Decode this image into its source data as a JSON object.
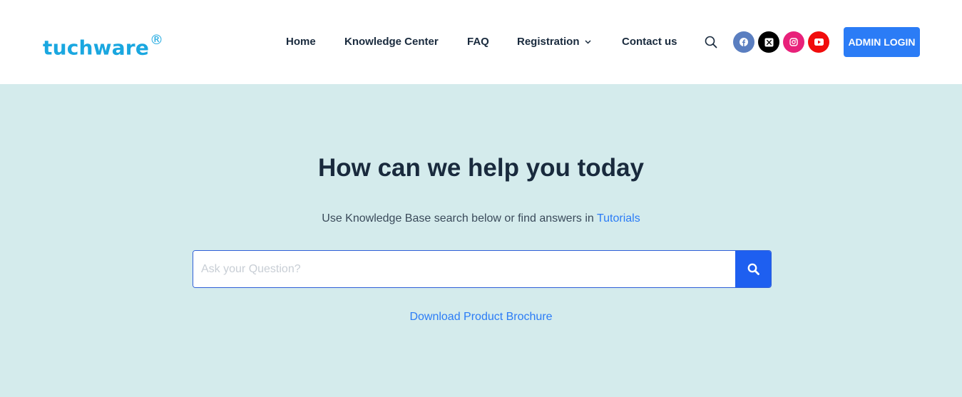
{
  "header": {
    "logo_text": "tuchware",
    "logo_mark": "®",
    "nav": [
      {
        "label": "Home"
      },
      {
        "label": "Knowledge Center"
      },
      {
        "label": "FAQ"
      },
      {
        "label": "Registration"
      },
      {
        "label": "Contact us"
      }
    ],
    "search_icon": "search-icon",
    "social": [
      {
        "icon": "facebook-icon",
        "color": "#5a7ec0"
      },
      {
        "icon": "x-twitter-icon",
        "color": "#000000"
      },
      {
        "icon": "instagram-icon",
        "color": "#e8217a"
      },
      {
        "icon": "youtube-icon",
        "color": "#f10c0c"
      }
    ],
    "admin_login_label": "ADMIN LOGIN"
  },
  "hero": {
    "title": "How can we help you today",
    "subtitle_prefix": "Use Knowledge Base search below or find answers in",
    "subtitle_link": "Tutorials",
    "search_placeholder": "Ask your Question?",
    "search_value": "",
    "brochure_link": "Download Product Brochure"
  },
  "colors": {
    "accent": "#2b7cf6",
    "logo": "#1aa7e0",
    "hero_bg": "#d4ebec",
    "search_button": "#1e5ff0"
  }
}
